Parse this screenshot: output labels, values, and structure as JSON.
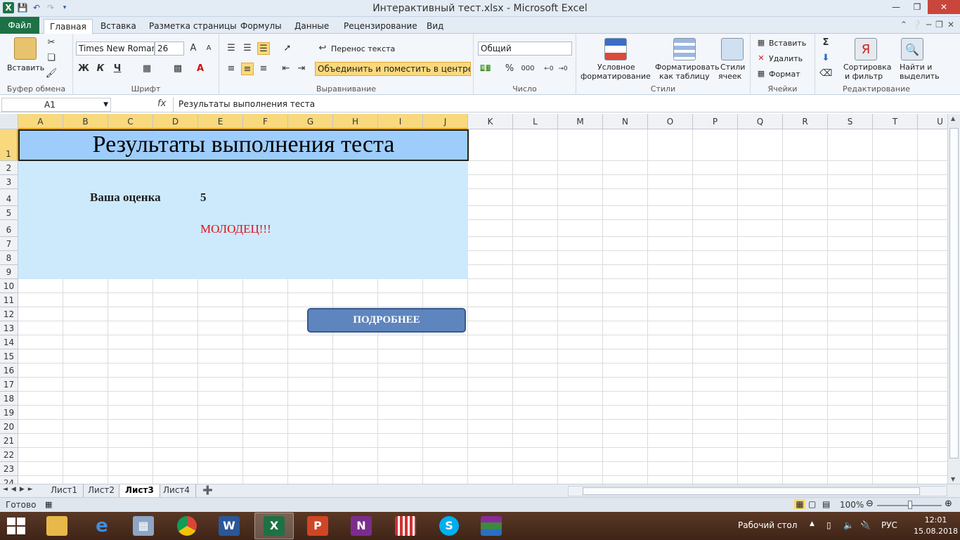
{
  "window": {
    "title": "Интерактивный тест.xlsx - Microsoft Excel"
  },
  "tabs": {
    "file": "Файл",
    "items": [
      "Главная",
      "Вставка",
      "Разметка страницы",
      "Формулы",
      "Данные",
      "Рецензирование",
      "Вид"
    ],
    "active": "Главная"
  },
  "ribbon": {
    "clipboard": {
      "paste": "Вставить",
      "label": "Буфер обмена"
    },
    "font": {
      "name": "Times New Roman",
      "size": "26",
      "bold": "Ж",
      "italic": "К",
      "underline": "Ч",
      "label": "Шрифт"
    },
    "alignment": {
      "wrap": "Перенос текста",
      "merge": "Объединить и поместить в центре",
      "label": "Выравнивание"
    },
    "number": {
      "format": "Общий",
      "percent": "%",
      "thousands": "000",
      "label": "Число"
    },
    "styles": {
      "conditional_1": "Условное",
      "conditional_2": "форматирование",
      "table_1": "Форматировать",
      "table_2": "как таблицу",
      "cell_1": "Стили",
      "cell_2": "ячеек",
      "label": "Стили"
    },
    "cells": {
      "insert": "Вставить",
      "delete": "Удалить",
      "format": "Формат",
      "label": "Ячейки"
    },
    "editing": {
      "sort_1": "Сортировка",
      "sort_2": "и фильтр",
      "find_1": "Найти и",
      "find_2": "выделить",
      "label": "Редактирование"
    }
  },
  "formula_bar": {
    "name_box": "A1",
    "fx": "fx",
    "formula": "Результаты выполнения теста"
  },
  "columns": [
    "A",
    "B",
    "C",
    "D",
    "E",
    "F",
    "G",
    "H",
    "I",
    "J",
    "K",
    "L",
    "M",
    "N",
    "O",
    "P",
    "Q",
    "R",
    "S",
    "T",
    "U"
  ],
  "rows": [
    "1",
    "2",
    "3",
    "4",
    "5",
    "6",
    "7",
    "8",
    "9",
    "10",
    "11",
    "12",
    "13",
    "14",
    "15",
    "16",
    "17",
    "18",
    "19",
    "20",
    "21",
    "22",
    "23",
    "24"
  ],
  "cells": {
    "title": "Результаты выполнения теста",
    "grade_label": "Ваша оценка",
    "grade_value": "5",
    "message": "МОЛОДЕЦ!!!"
  },
  "button": {
    "label": "ПОДРОБНЕЕ"
  },
  "sheets": {
    "items": [
      "Лист1",
      "Лист2",
      "Лист3",
      "Лист4"
    ],
    "active": "Лист3"
  },
  "status": {
    "ready": "Готово",
    "zoom": "100%"
  },
  "taskbar": {
    "desktop": "Рабочий стол",
    "lang": "РУС",
    "time": "12:01",
    "date": "15.08.2018"
  },
  "colors": {
    "title_fill": "#9FCDFB",
    "area_fill": "#CDEAFD",
    "message": "#E0101F",
    "button": "#5E85BD",
    "excel_green": "#1E7145"
  }
}
